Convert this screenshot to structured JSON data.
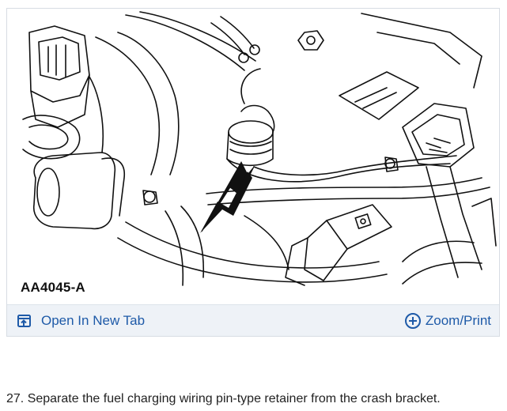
{
  "figure": {
    "code": "AA4045-A"
  },
  "toolbar": {
    "open_label": "Open In New Tab",
    "zoom_label": "Zoom/Print",
    "accent_color": "#1e5aa8",
    "open_icon": "open-new-tab-icon",
    "zoom_icon": "plus-circle-icon"
  },
  "caption": {
    "text": "27. Separate the fuel charging wiring pin-type retainer from the crash bracket."
  }
}
